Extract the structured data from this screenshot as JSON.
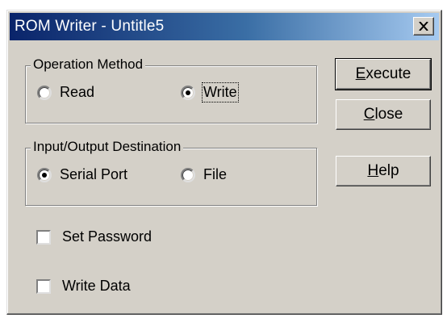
{
  "window": {
    "title": "ROM Writer - Untitle5",
    "close_icon": "close-x-icon"
  },
  "operation_method": {
    "label": "Operation Method",
    "options": [
      {
        "label": "Read",
        "selected": false
      },
      {
        "label": "Write",
        "selected": true
      }
    ]
  },
  "io_destination": {
    "label": "Input/Output Destination",
    "options": [
      {
        "label": "Serial Port",
        "selected": true
      },
      {
        "label": "File",
        "selected": false
      }
    ]
  },
  "checkboxes": {
    "set_password": {
      "label": "Set Password",
      "checked": false
    },
    "write_data": {
      "label": "Write Data",
      "checked": false
    }
  },
  "buttons": {
    "execute": {
      "mnemonic": "E",
      "rest": "xecute"
    },
    "close": {
      "mnemonic": "C",
      "rest": "lose"
    },
    "help": {
      "mnemonic": "H",
      "rest": "elp"
    }
  },
  "colors": {
    "face": "#d4d0c8",
    "title_start": "#0a246a",
    "title_end": "#a6caf0"
  }
}
